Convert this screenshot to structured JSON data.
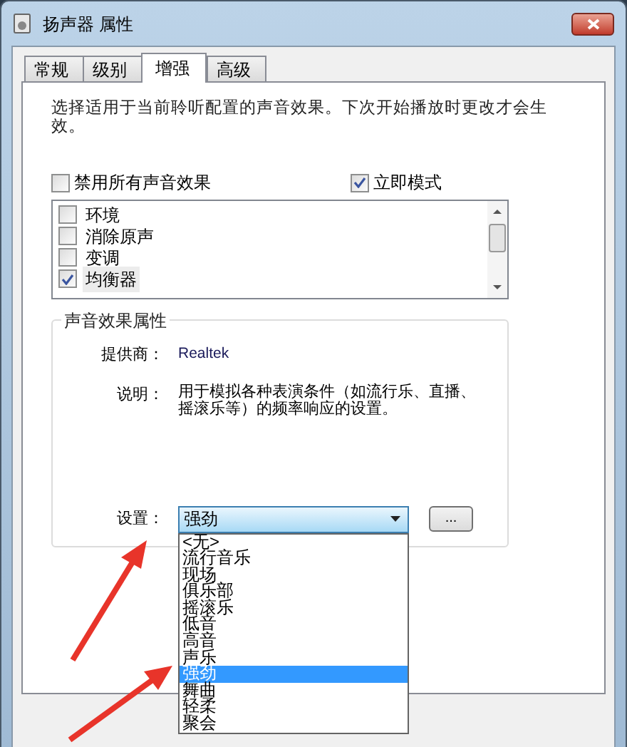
{
  "window": {
    "title": "扬声器 属性"
  },
  "tabs": [
    {
      "label": "常规",
      "selected": false
    },
    {
      "label": "级别",
      "selected": false
    },
    {
      "label": "增强",
      "selected": true
    },
    {
      "label": "高级",
      "selected": false
    }
  ],
  "intro": "选择适用于当前聆听配置的声音效果。下次开始播放时更改才会生效。",
  "disable_all": {
    "label": "禁用所有声音效果",
    "checked": false
  },
  "immediate_mode": {
    "label": "立即模式",
    "checked": true
  },
  "effects": [
    {
      "label": "环境",
      "checked": false,
      "selected": false
    },
    {
      "label": "消除原声",
      "checked": false,
      "selected": false
    },
    {
      "label": "变调",
      "checked": false,
      "selected": false
    },
    {
      "label": "均衡器",
      "checked": true,
      "selected": true
    }
  ],
  "properties": {
    "title": "声音效果属性",
    "provider_label": "提供商：",
    "provider": "Realtek",
    "description_label": "说明：",
    "description": "用于模拟各种表演条件（如流行乐、直播、摇滚乐等）的频率响应的设置。",
    "setting_label": "设置：",
    "setting_value": "强劲",
    "more_button": "...",
    "options": [
      {
        "label": "<无>",
        "selected": false
      },
      {
        "label": "流行音乐",
        "selected": false
      },
      {
        "label": "现场",
        "selected": false
      },
      {
        "label": "俱乐部",
        "selected": false
      },
      {
        "label": "摇滚乐",
        "selected": false
      },
      {
        "label": "低音",
        "selected": false
      },
      {
        "label": "高音",
        "selected": false
      },
      {
        "label": "声乐",
        "selected": false
      },
      {
        "label": "强劲",
        "selected": true
      },
      {
        "label": "舞曲",
        "selected": false
      },
      {
        "label": "轻柔",
        "selected": false
      },
      {
        "label": "聚会",
        "selected": false
      }
    ]
  }
}
